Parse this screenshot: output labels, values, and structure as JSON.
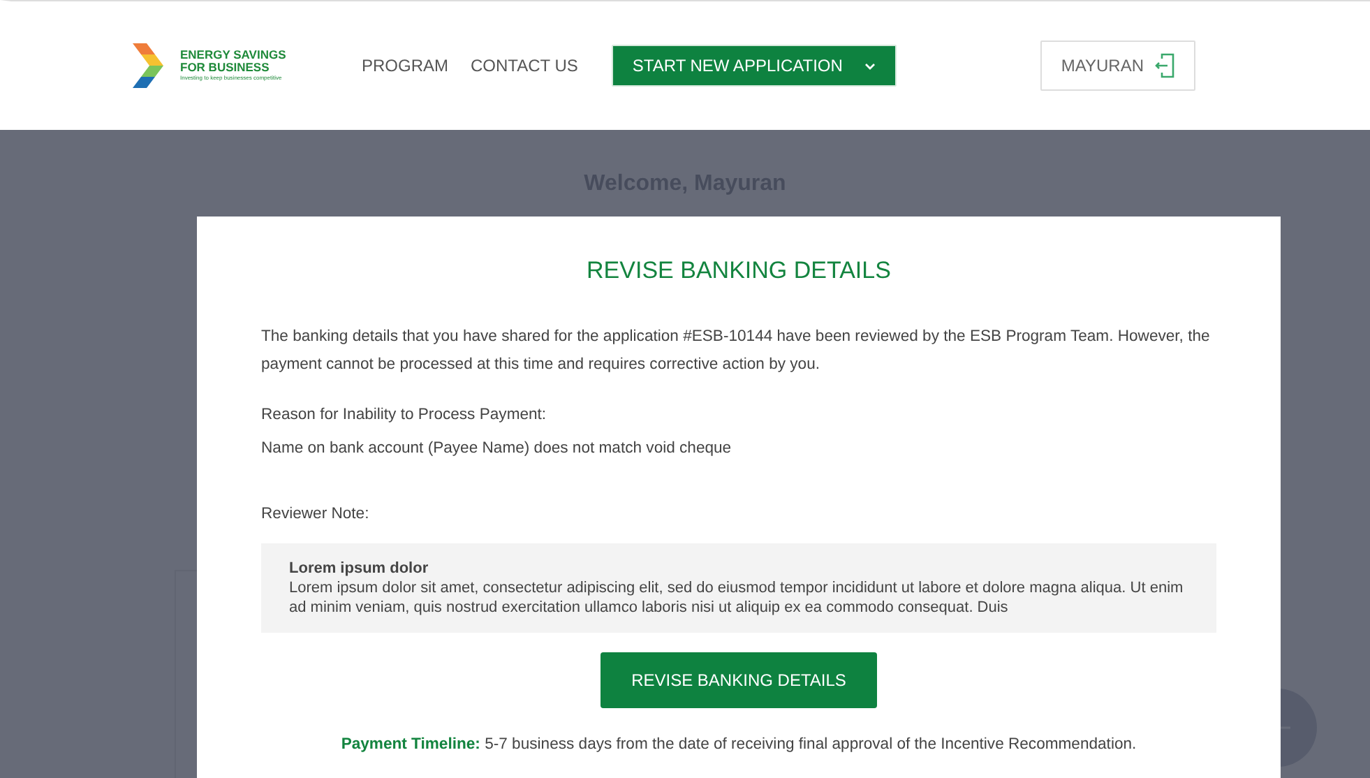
{
  "header": {
    "logo": {
      "line1": "ENERGY SAVINGS",
      "line2": "FOR BUSINESS",
      "tagline": "Investing to keep businesses competitive"
    },
    "nav": [
      {
        "label": "PROGRAM"
      },
      {
        "label": "CONTACT US"
      }
    ],
    "start_button": {
      "label": "START NEW APPLICATION"
    },
    "user": {
      "name": "MAYURAN"
    }
  },
  "background": {
    "welcome": "Welcome, Mayuran"
  },
  "modal": {
    "title": "REVISE BANKING DETAILS",
    "intro": "The banking details that you have shared for the application #ESB-10144 have been reviewed by the ESB Program Team. However, the payment cannot be processed at this time and requires corrective action by you.",
    "reason_label": "Reason for Inability to Process Payment:",
    "reason": "Name on bank account (Payee Name) does not match void cheque",
    "note_label": "Reviewer Note:",
    "note": {
      "title": "Lorem ipsum dolor",
      "body": "Lorem ipsum dolor sit amet, consectetur adipiscing elit, sed do eiusmod tempor incididunt ut labore et dolore magna aliqua. Ut enim ad minim veniam, quis nostrud exercitation ullamco laboris nisi ut aliquip ex ea commodo consequat. Duis"
    },
    "button": "REVISE BANKING DETAILS",
    "timeline": "**Payment Timeline:** 5-7 business days from the date of receiving final approval of the Incentive Recommendation."
  }
}
